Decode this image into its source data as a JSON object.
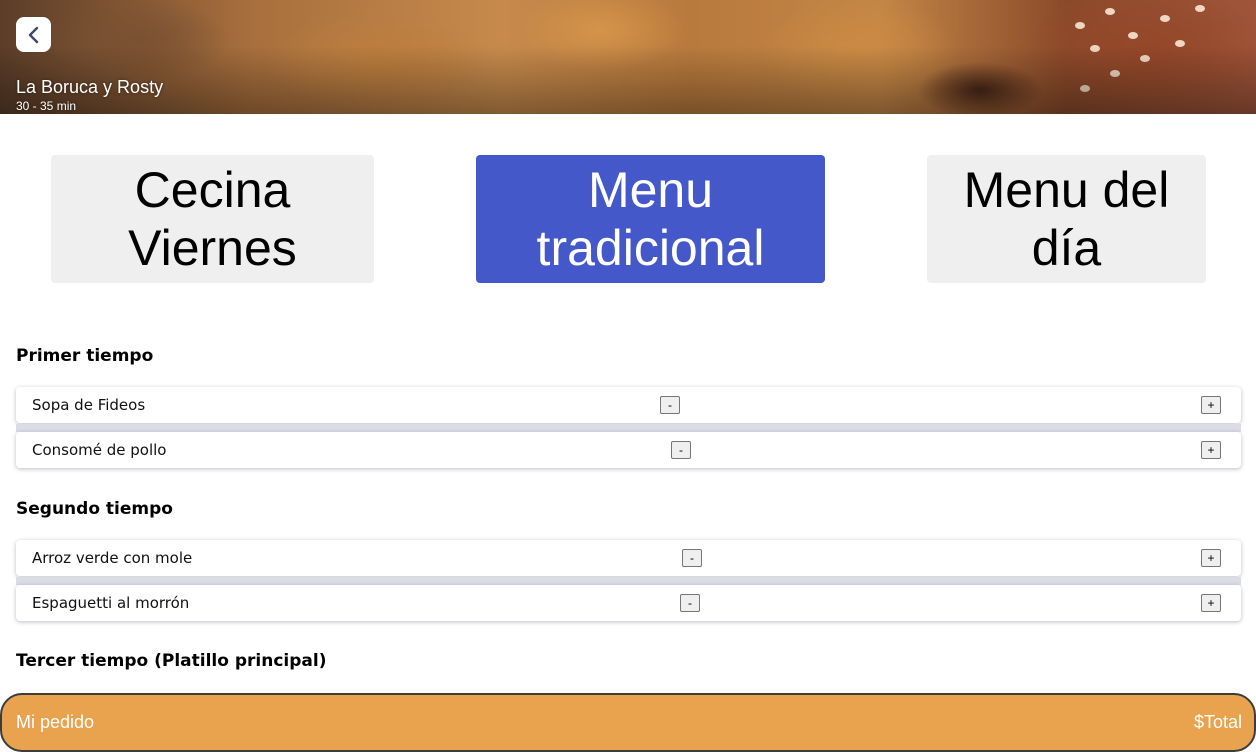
{
  "restaurant": {
    "name": "La Boruca y Rosty",
    "delivery_time": "30 - 35 min"
  },
  "header": {
    "back_icon": "chevron-left-icon"
  },
  "menu_tabs": [
    {
      "label": "Cecina Viernes",
      "active": false
    },
    {
      "label": "Menu tradicional",
      "active": true
    },
    {
      "label": "Menu del día",
      "active": false
    }
  ],
  "sections": [
    {
      "title": "Primer tiempo",
      "items": [
        {
          "name": "Sopa de Fideos",
          "minus": "-",
          "plus": "+"
        },
        {
          "name": "Consomé de pollo",
          "minus": "-",
          "plus": "+"
        }
      ]
    },
    {
      "title": "Segundo tiempo",
      "items": [
        {
          "name": "Arroz verde con mole",
          "minus": "-",
          "plus": "+"
        },
        {
          "name": "Espaguetti al morrón",
          "minus": "-",
          "plus": "+"
        }
      ]
    },
    {
      "title": "Tercer tiempo (Platillo principal)",
      "items": []
    }
  ],
  "order_bar": {
    "label": "Mi pedido",
    "total": "$Total"
  },
  "colors": {
    "active_tab": "#4558c9",
    "inactive_tab": "#efefef",
    "order_bar": "#e9a34e"
  }
}
